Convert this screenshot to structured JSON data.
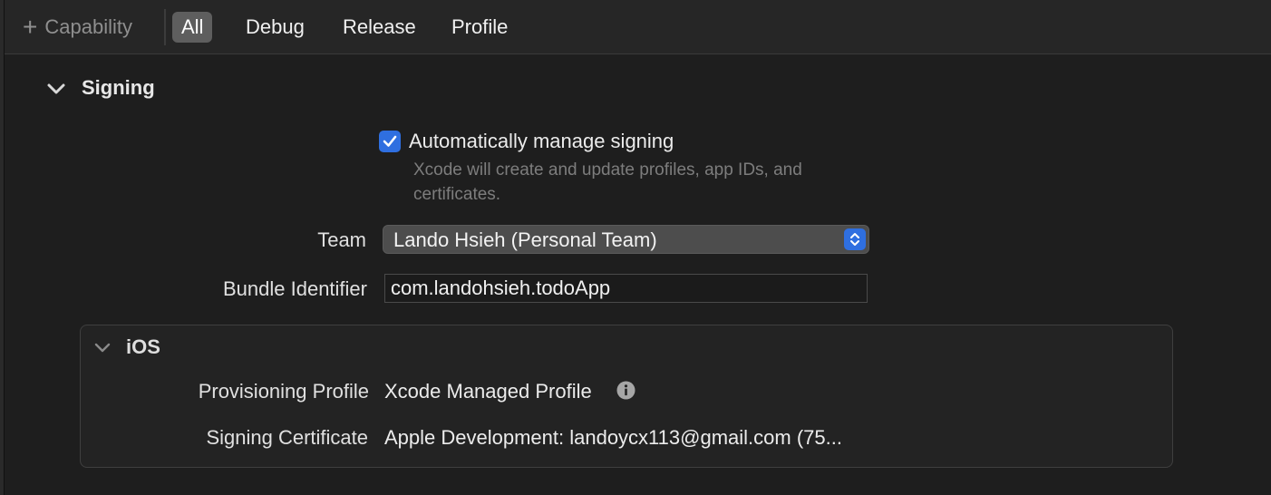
{
  "toolbar": {
    "capability_label": "Capability",
    "tabs": [
      {
        "label": "All",
        "active": true
      },
      {
        "label": "Debug",
        "active": false
      },
      {
        "label": "Release",
        "active": false
      },
      {
        "label": "Profile",
        "active": false
      }
    ]
  },
  "signing": {
    "title": "Signing",
    "auto_manage": {
      "label": "Automatically manage signing",
      "checked": true,
      "help_line1": "Xcode will create and update profiles, app IDs, and",
      "help_line2": "certificates."
    },
    "team": {
      "label": "Team",
      "value": "Lando Hsieh (Personal Team)"
    },
    "bundle_identifier": {
      "label": "Bundle Identifier",
      "value": "com.landohsieh.todoApp"
    },
    "ios": {
      "title": "iOS",
      "provisioning_profile": {
        "label": "Provisioning Profile",
        "value": "Xcode Managed Profile"
      },
      "signing_certificate": {
        "label": "Signing Certificate",
        "value": "Apple Development: landoycx113@gmail.com (75..."
      }
    }
  },
  "colors": {
    "accent": "#2f6fe0",
    "background": "#1e1e1e",
    "active_tab": "#5e5e5e"
  },
  "icons": [
    "plus-icon",
    "chevron-down-icon",
    "checkmark-icon",
    "updown-arrows-icon",
    "info-icon"
  ]
}
